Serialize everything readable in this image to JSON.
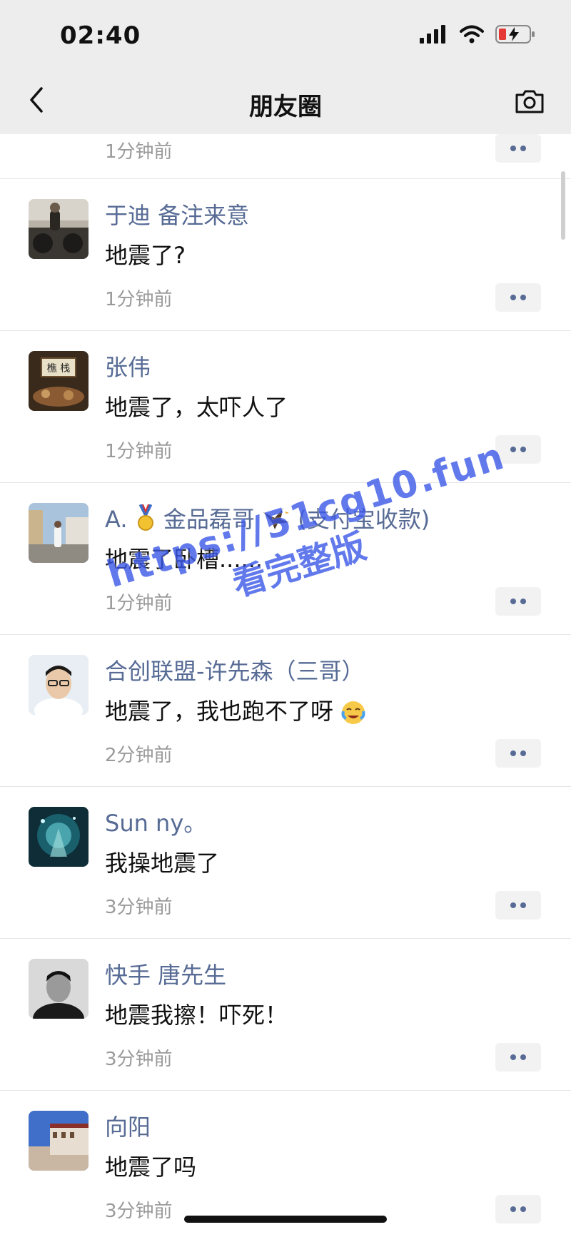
{
  "status_bar": {
    "time": "02:40"
  },
  "nav": {
    "title": "朋友圈"
  },
  "partial_post": {
    "time_ago": "1分钟前"
  },
  "posts": [
    {
      "name": "于迪 备注来意",
      "content": "地震了?",
      "time_ago": "1分钟前"
    },
    {
      "name": "张伟",
      "content": "地震了，太吓人了",
      "time_ago": "1分钟前"
    },
    {
      "name_prefix": "A.",
      "name_mid": "金品磊哥",
      "name_suffix": "(支付宝收款)",
      "content": "地震了卧槽......",
      "time_ago": "1分钟前"
    },
    {
      "name": "合创联盟-许先森（三哥）",
      "content": "地震了，我也跑不了呀",
      "time_ago": "2分钟前"
    },
    {
      "name": "Sun ny。",
      "content": "我操地震了",
      "time_ago": "3分钟前"
    },
    {
      "name": "快手 唐先生",
      "content": "地震我擦！吓死！",
      "time_ago": "3分钟前"
    },
    {
      "name": "向阳",
      "content": "地震了吗",
      "time_ago": "3分钟前"
    }
  ],
  "watermark": {
    "line1": "https://51cg10.fun",
    "line2": "看完整版"
  },
  "colors": {
    "name": "#576b95",
    "background": "#ededed",
    "watermark": "#3b58e8"
  },
  "icons": [
    "back-icon",
    "camera-icon",
    "signal-icon",
    "wifi-icon",
    "battery-icon",
    "more-dots-icon",
    "medal-emoji-icon",
    "eagle-emoji-icon",
    "crying-emoji-icon"
  ]
}
